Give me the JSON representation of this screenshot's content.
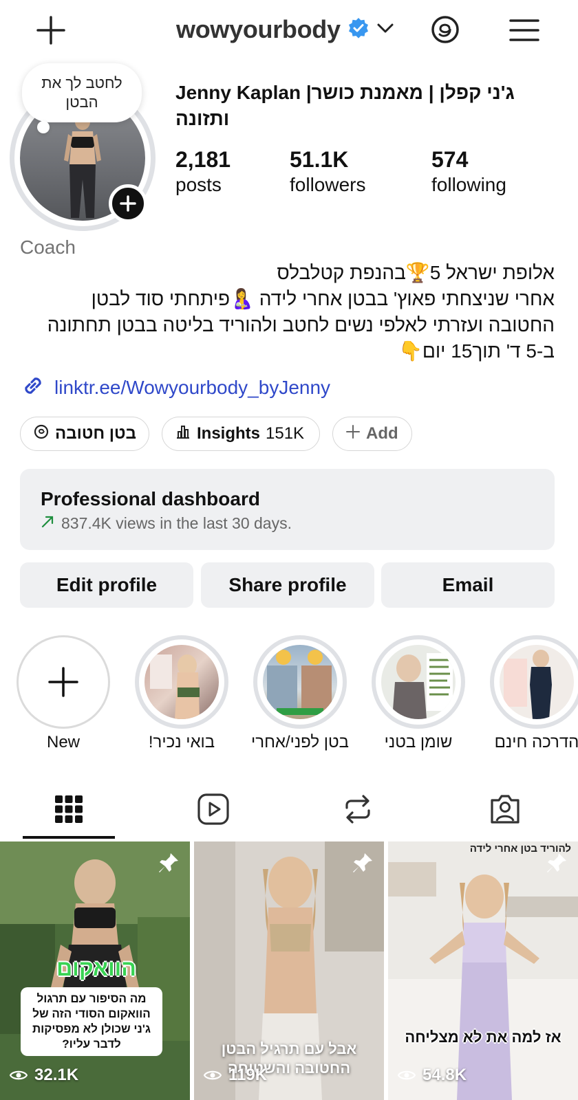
{
  "header": {
    "username": "wowyourbody",
    "verified": true
  },
  "profile": {
    "note": "לחטב לך את הבטן",
    "full_name": "Jenny Kaplan |ג'ני קפלן | מאמנת כושר ותזונה",
    "stats": [
      {
        "value": "2,181",
        "label": "posts"
      },
      {
        "value": "51.1K",
        "label": "followers"
      },
      {
        "value": "574",
        "label": "following"
      }
    ]
  },
  "bio": {
    "category": "Coach",
    "lines": [
      "אלופת ישראל 5🏆בהנפת קטלבלס",
      "אחרי שניצחתי פאוץ' בבטן אחרי לידה 🤱פיתחתי סוד לבטן",
      "החטובה ועזרתי לאלפי נשים לחטב ולהוריד בליטה בבטן תחתונה",
      "ב-5 ד' תוך15 יום👇"
    ],
    "link": "linktr.ee/Wowyourbody_byJenny"
  },
  "pills": {
    "threads_label": "בטן חטובה",
    "insights_label": "Insights",
    "insights_value": "151K",
    "add_label": "Add"
  },
  "dashboard": {
    "title": "Professional dashboard",
    "subtitle": "837.4K views in the last 30 days."
  },
  "actions": {
    "edit": "Edit profile",
    "share": "Share profile",
    "email": "Email"
  },
  "highlights": [
    {
      "label": "New"
    },
    {
      "label": "בואי נכיר!"
    },
    {
      "label": "בטן לפני/אחרי"
    },
    {
      "label": "שומן בטני"
    },
    {
      "label": "הדרכה חינם"
    }
  ],
  "grid": [
    {
      "views": "32.1K",
      "caption_title": "הוואקום",
      "caption_body": "מה הסיפור עם תרגול הוואקום הסודי הזה של ג'ני שכולן לא מפסיקות לדבר עליו?"
    },
    {
      "views": "119K",
      "caption_body": "אבל עם תרגיל הבטן החטובה והשטוחה"
    },
    {
      "views": "54.8K",
      "caption_top": "להוריד בטן אחרי לידה",
      "caption_body": "אז למה את לא מצליחה"
    }
  ],
  "colors": {
    "verified": "#3897f0",
    "link": "#2f48c9",
    "accent_green": "#1e8e3e",
    "caption_green": "#39d353"
  }
}
